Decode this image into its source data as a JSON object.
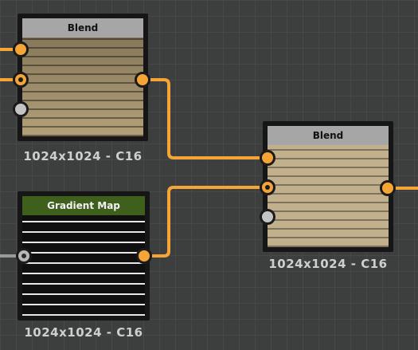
{
  "nodes": {
    "blend_top": {
      "title": "Blend",
      "resolution": "1024x1024 - C16"
    },
    "gradient_map": {
      "title": "Gradient Map",
      "resolution": "1024x1024 - C16"
    },
    "blend_right": {
      "title": "Blend",
      "resolution": "1024x1024 - C16"
    }
  },
  "colors": {
    "wire": "#f4a535",
    "wire_gray": "#9a9a9a",
    "canvas": "#3c3f3e",
    "blend_header": "#a6a6a6",
    "gradient_header": "#3f5f1c"
  }
}
